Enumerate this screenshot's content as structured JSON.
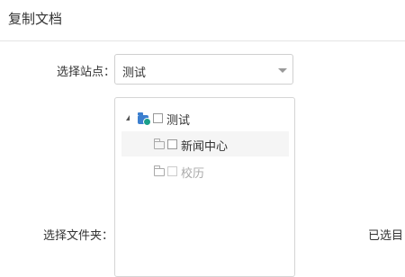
{
  "dialog": {
    "title": "复制文档"
  },
  "form": {
    "site_label": "选择站点：",
    "site_value": "测试",
    "folder_label": "选择文件夹：",
    "selected_label": "已选目"
  },
  "tree": {
    "root": {
      "label": "测试",
      "expanded": true
    },
    "children": [
      {
        "label": "新闻中心",
        "disabled": false,
        "highlighted": true
      },
      {
        "label": "校历",
        "disabled": true,
        "highlighted": false
      }
    ]
  },
  "icons": {
    "expand": "triangle-expanded-icon",
    "site": "site-icon",
    "folder": "folder-icon",
    "select_caret": "chevron-down-icon"
  },
  "colors": {
    "site_icon": "#3c7fcf",
    "disabled_text": "#aaaaaa",
    "highlight_bg": "#f5f5f5"
  }
}
